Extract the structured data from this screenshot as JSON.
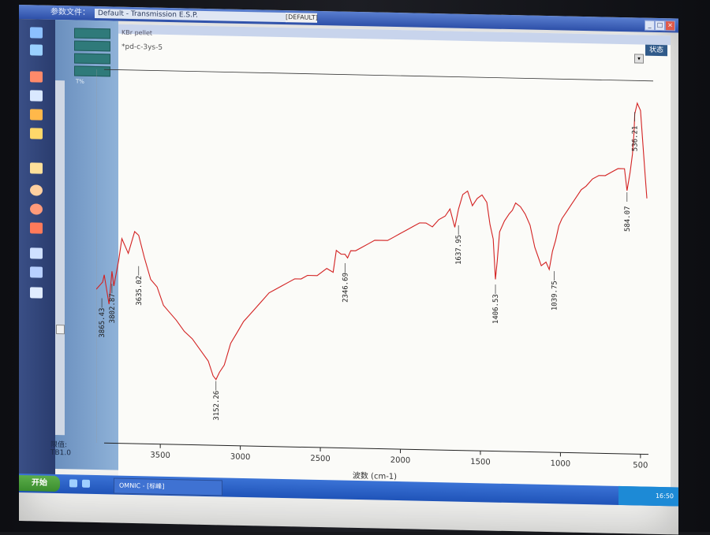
{
  "window": {
    "menu_label": "参数文件：",
    "param_file": "Default - Transmission E.S.P.",
    "default_button": "[DEFAULT]",
    "min_label": "_",
    "max_label": "□",
    "close_label": "×",
    "status_button": "状态"
  },
  "sidebar": {
    "panel_label": "T%",
    "status_label": "限值:",
    "status_value": "TB1.0",
    "icons": [
      "spectrum-icon",
      "spectrum-icon",
      "table-icon",
      "chart-icon",
      "folder-icon",
      "qc-icon",
      "zoom-icon",
      "library-icon",
      "pen-icon",
      "multi-spectrum-icon",
      "export-icon",
      "compare-icon"
    ]
  },
  "main": {
    "subtitle": "KBr pellet",
    "sample_name": "*pd-c-3ys-5"
  },
  "taskbar": {
    "start_label": "开始",
    "task_label": "OMNIC - [标峰]",
    "clock": "16:50"
  },
  "chart_data": {
    "type": "line",
    "xlabel": "波数 (cm-1)",
    "ylabel": "",
    "title": "",
    "x_reversed": true,
    "xlim": [
      3900,
      450
    ],
    "ylim": [
      0,
      100
    ],
    "x_ticks": [
      3500,
      3000,
      2500,
      2000,
      1500,
      1000,
      500
    ],
    "y_ticks": [
      0,
      20,
      50
    ],
    "grid": false,
    "series": [
      {
        "color": "#d32222",
        "x": [
          3900,
          3860,
          3850,
          3820,
          3802,
          3790,
          3760,
          3740,
          3700,
          3660,
          3635,
          3600,
          3560,
          3520,
          3480,
          3440,
          3400,
          3350,
          3300,
          3250,
          3200,
          3170,
          3152,
          3130,
          3100,
          3060,
          3020,
          2980,
          2940,
          2900,
          2860,
          2820,
          2780,
          2740,
          2700,
          2660,
          2620,
          2580,
          2520,
          2460,
          2420,
          2400,
          2370,
          2346,
          2330,
          2310,
          2280,
          2240,
          2200,
          2160,
          2120,
          2080,
          2040,
          2000,
          1960,
          1920,
          1880,
          1840,
          1800,
          1760,
          1720,
          1690,
          1660,
          1637,
          1610,
          1580,
          1550,
          1520,
          1490,
          1460,
          1440,
          1420,
          1406,
          1395,
          1380,
          1350,
          1320,
          1300,
          1280,
          1250,
          1220,
          1190,
          1160,
          1120,
          1090,
          1070,
          1050,
          1030,
          1010,
          990,
          960,
          930,
          900,
          870,
          840,
          800,
          760,
          720,
          680,
          640,
          600,
          584,
          565,
          550,
          540,
          536,
          520,
          500,
          490,
          480,
          470,
          460
        ],
        "y": [
          42,
          44,
          46,
          38,
          47,
          43,
          50,
          56,
          52,
          58,
          57,
          51,
          45,
          43,
          38,
          36,
          34,
          31,
          29,
          26,
          23,
          19,
          18,
          20,
          22,
          28,
          31,
          34,
          36,
          38,
          40,
          42,
          43,
          44,
          45,
          46,
          46,
          47,
          47,
          49,
          48,
          54,
          53,
          53,
          52,
          54,
          54,
          55,
          56,
          57,
          57,
          57,
          58,
          59,
          60,
          61,
          62,
          62,
          61,
          63,
          64,
          66,
          61,
          66,
          70,
          71,
          67,
          69,
          70,
          68,
          62,
          58,
          47,
          52,
          60,
          63,
          65,
          66,
          68,
          67,
          65,
          62,
          56,
          51,
          52,
          50,
          55,
          58,
          62,
          64,
          66,
          68,
          70,
          72,
          73,
          75,
          76,
          76,
          77,
          78,
          78,
          72,
          77,
          82,
          88,
          93,
          96,
          94,
          88,
          82,
          76,
          70
        ]
      }
    ],
    "annotations": [
      {
        "label": "3865.43",
        "x": 3865,
        "y": 40
      },
      {
        "label": "3802.87",
        "x": 3802,
        "y": 44
      },
      {
        "label": "3635.02",
        "x": 3635,
        "y": 49
      },
      {
        "label": "3152.26",
        "x": 3152,
        "y": 18
      },
      {
        "label": "2346.69",
        "x": 2346,
        "y": 51
      },
      {
        "label": "1637.95",
        "x": 1637,
        "y": 62
      },
      {
        "label": "1406.53",
        "x": 1406,
        "y": 46
      },
      {
        "label": "1039.75",
        "x": 1039,
        "y": 50
      },
      {
        "label": "584.07",
        "x": 584,
        "y": 72
      },
      {
        "label": "536.21",
        "x": 536,
        "y": 94
      }
    ],
    "y_axis_left_value": "T%"
  }
}
